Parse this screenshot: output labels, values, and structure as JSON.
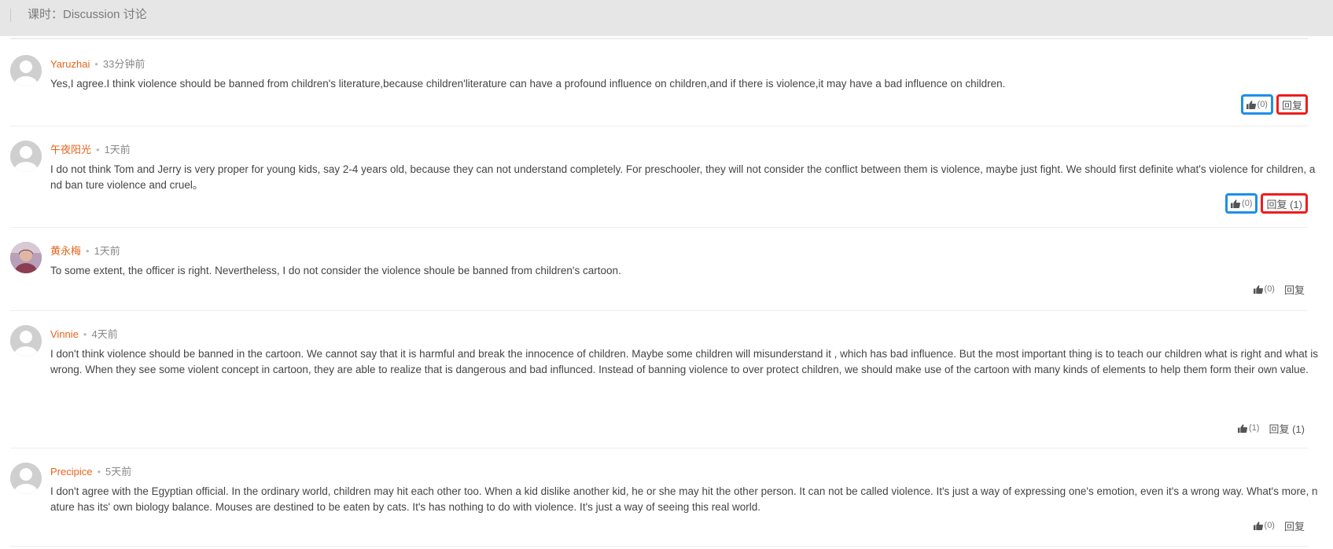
{
  "header": {
    "title": "课时：Discussion 讨论"
  },
  "colors": {
    "username": "#e8641a",
    "highlight_like": "#1e8fe8",
    "highlight_reply": "#ee1d1d"
  },
  "comments": [
    {
      "user": "Yaruzhai",
      "time": "33分钟前",
      "text": "Yes,I agree.I think violence should be banned from children's literature,because children'literature can have a profound influence on children,and if there is violence,it may have a bad influence on children.",
      "like_count": "(0)",
      "reply_label": "回复",
      "highlighted": true
    },
    {
      "user": "午夜阳光",
      "time": "1天前",
      "text": "I do not think Tom and Jerry is very proper for young kids, say 2-4 years old, because they can not understand completely. For preschooler, they will  not consider the conflict between them is violence, maybe just fight. We should first definite what's violence for children, and ban ture violence and cruel。",
      "like_count": "(0)",
      "reply_label": "回复 (1)",
      "highlighted": true
    },
    {
      "user": "黄永梅",
      "time": "1天前",
      "text": "To some extent, the officer is right. Nevertheless, I do not consider the violence shoule be banned from children's cartoon.",
      "like_count": "(0)",
      "reply_label": "回复",
      "highlighted": false
    },
    {
      "user": "Vinnie",
      "time": "4天前",
      "text": "I don't think violence should be banned in the cartoon. We cannot say that it is harmful and break the innocence of children. Maybe some children will misunderstand it , which has bad influence. But the most important thing is to teach our children what is right and what is wrong. When they see some violent concept in cartoon, they are able to realize that is dangerous and bad influnced. Instead of banning violence to over protect children, we should make use of the cartoon with many kinds of elements to help them form their own value.",
      "like_count": "(1)",
      "reply_label": "回复 (1)",
      "highlighted": false
    },
    {
      "user": "Precipice",
      "time": "5天前",
      "text": "I don't agree with the Egyptian official. In the ordinary world, children may hit each other too. When a kid dislike another kid, he or she may hit the other person. It can not be called violence. It's just a way of expressing one's emotion, even it's a wrong way. What's more, nature has its' own biology balance. Mouses are destined to be eaten by cats. It's has nothing to do with violence. It's just a way of seeing this real world.",
      "like_count": "(0)",
      "reply_label": "回复",
      "highlighted": false
    }
  ]
}
